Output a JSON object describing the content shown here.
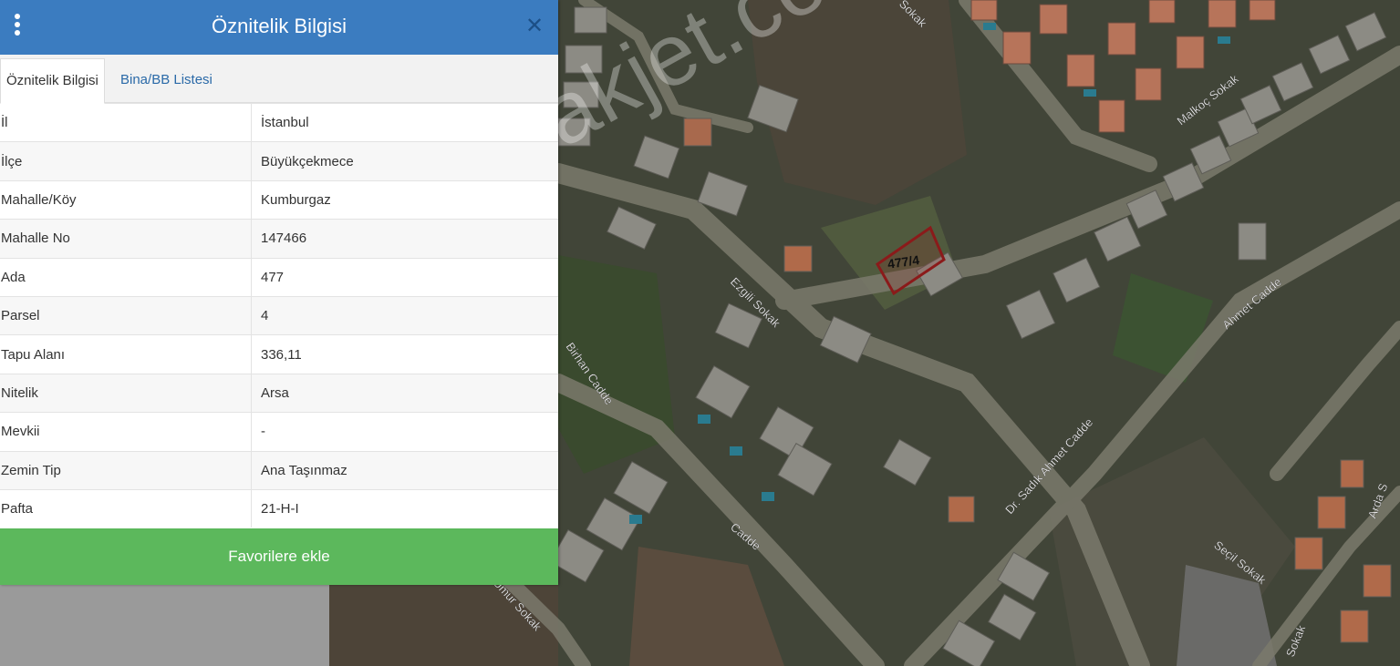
{
  "panel": {
    "title": "Öznitelik Bilgisi",
    "tabs": [
      {
        "label": "Öznitelik Bilgisi",
        "active": true
      },
      {
        "label": "Bina/BB Listesi",
        "active": false
      }
    ],
    "rows": [
      {
        "key": "İl",
        "value": "İstanbul"
      },
      {
        "key": "İlçe",
        "value": "Büyükçekmece"
      },
      {
        "key": "Mahalle/Köy",
        "value": "Kumburgaz"
      },
      {
        "key": "Mahalle No",
        "value": "147466"
      },
      {
        "key": "Ada",
        "value": "477"
      },
      {
        "key": "Parsel",
        "value": "4"
      },
      {
        "key": "Tapu Alanı",
        "value": "336,11"
      },
      {
        "key": "Nitelik",
        "value": "Arsa"
      },
      {
        "key": "Mevkii",
        "value": "-"
      },
      {
        "key": "Zemin Tip",
        "value": "Ana Taşınmaz"
      },
      {
        "key": "Pafta",
        "value": "21-H-I"
      }
    ],
    "favorite_button": "Favorilere ekle",
    "icons": {
      "menu": "kebab-menu-icon",
      "close": "close-icon"
    },
    "colors": {
      "header": "#3b7cc0",
      "button": "#5cb85c"
    }
  },
  "map": {
    "parcel_label": "477/4",
    "watermark": "emlakjet.com",
    "streets": [
      "Sokak",
      "Malkoç Sokak",
      "Ezgili Sokak",
      "Ahmet Cadde",
      "Birhan Cadde",
      "Dr. Sadık Ahmet Cadde",
      "Cadde",
      "Seçil Sokak",
      "Umur Sokak",
      "Arda S",
      "Sokak"
    ]
  }
}
